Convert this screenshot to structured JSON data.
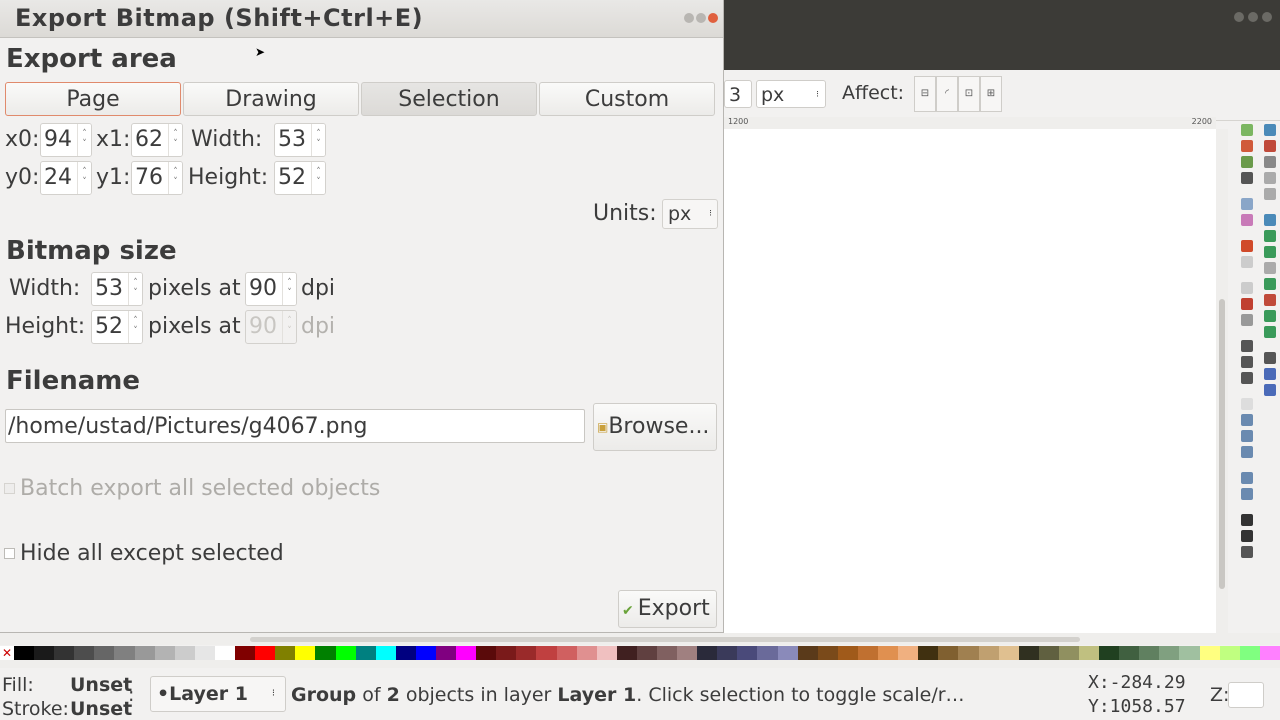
{
  "dialog": {
    "title": "Export Bitmap (Shift+Ctrl+E)",
    "export_area": {
      "heading": "Export area",
      "tabs": [
        "Page",
        "Drawing",
        "Selection",
        "Custom"
      ],
      "x0_label": "x0:",
      "x0_value": "94",
      "x1_label": "x1:",
      "x1_value": "62",
      "width_label": "Width:",
      "width_value": "53",
      "y0_label": "y0:",
      "y0_value": "24",
      "y1_label": "y1:",
      "y1_value": "76",
      "height_label": "Height:",
      "height_value": "52",
      "units_label": "Units:",
      "units_value": "px"
    },
    "bitmap_size": {
      "heading": "Bitmap size",
      "width_label": "Width:",
      "width_value": "53",
      "height_label": "Height:",
      "height_value": "52",
      "pixels_at": "pixels at",
      "dpi_x": "90",
      "dpi_y": "90",
      "dpi_label": "dpi"
    },
    "filename": {
      "heading": "Filename",
      "value": "/home/ustad/Pictures/g4067.png",
      "browse_label": "Browse..."
    },
    "batch_export_label": "Batch export all selected objects",
    "hide_all_label": "Hide all except selected",
    "export_label": "Export"
  },
  "toolbar": {
    "spin_value": "3",
    "unit": "px",
    "affect_label": "Affect:"
  },
  "ruler": {
    "tick_left": "1200",
    "tick_right": "2200"
  },
  "status": {
    "fill_label": "Fill:",
    "fill_value": "Unset",
    "stroke_label": "Stroke:",
    "stroke_value": "Unset",
    "layer_prefix": ":",
    "layer_name": "•Layer 1",
    "msg_group": "Group",
    "msg_of": " of ",
    "msg_count": "2",
    "msg_objects": " objects in layer ",
    "msg_layer": "Layer 1",
    "msg_rest": ". Click selection to toggle scale/r…",
    "x": "X:-284.29",
    "y": "Y:1058.57",
    "zoom_label": "Z:"
  },
  "palette": [
    "#000000",
    "#1a1a1a",
    "#333333",
    "#4d4d4d",
    "#666666",
    "#808080",
    "#999999",
    "#b3b3b3",
    "#cccccc",
    "#e6e6e6",
    "#ffffff",
    "#800000",
    "#ff0000",
    "#808000",
    "#ffff00",
    "#008000",
    "#00ff00",
    "#008080",
    "#00ffff",
    "#000080",
    "#0000ff",
    "#800080",
    "#ff00ff",
    "#5a0a0a",
    "#7a1a1a",
    "#9a2a2a",
    "#c04040",
    "#d06060",
    "#e09090",
    "#f0c0c0",
    "#402020",
    "#604040",
    "#806060",
    "#a08080",
    "#2a2a3a",
    "#3a3a5a",
    "#4a4a7a",
    "#6a6a9a",
    "#8a8aba",
    "#5a3a1a",
    "#7a4a1a",
    "#a05a1a",
    "#c07030",
    "#e09050",
    "#f0b080",
    "#403010",
    "#806030",
    "#a08050",
    "#c0a070",
    "#e0c090",
    "#303020",
    "#606040",
    "#909060",
    "#c0c080",
    "#204020",
    "#406040",
    "#608060",
    "#80a080",
    "#a0c0a0",
    "#ffff80",
    "#c0ff80",
    "#80ff80",
    "#ff80ff"
  ]
}
